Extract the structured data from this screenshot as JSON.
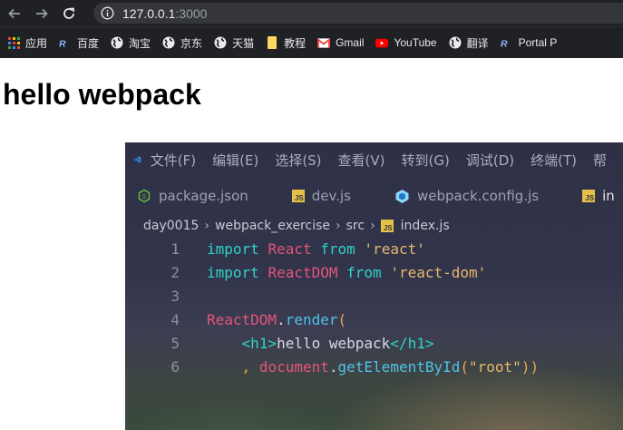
{
  "browser": {
    "url_host": "127.0.0.1",
    "url_port": ":3000",
    "bookmarks": [
      {
        "label": "应用",
        "icon": "apps-grid-icon"
      },
      {
        "label": "百度",
        "icon": "rb-logo-icon"
      },
      {
        "label": "淘宝",
        "icon": "globe-icon"
      },
      {
        "label": "京东",
        "icon": "globe-icon"
      },
      {
        "label": "天猫",
        "icon": "globe-icon"
      },
      {
        "label": "教程",
        "icon": "folder-icon"
      },
      {
        "label": "Gmail",
        "icon": "gmail-icon"
      },
      {
        "label": "YouTube",
        "icon": "youtube-icon"
      },
      {
        "label": "翻译",
        "icon": "globe-icon"
      },
      {
        "label": "Portal P",
        "icon": "rb-logo-icon"
      }
    ]
  },
  "page": {
    "heading": "hello webpack"
  },
  "vscode": {
    "menu": [
      "文件(F)",
      "编辑(E)",
      "选择(S)",
      "查看(V)",
      "转到(G)",
      "调试(D)",
      "终端(T)",
      "帮"
    ],
    "tabs": [
      {
        "label": "package.json",
        "icon": "npm-json-icon"
      },
      {
        "label": "dev.js",
        "icon": "js-file-icon"
      },
      {
        "label": "webpack.config.js",
        "icon": "webpack-icon"
      },
      {
        "label": "in",
        "icon": "js-file-icon"
      }
    ],
    "breadcrumb": [
      "day0015",
      "webpack_exercise",
      "src",
      "index.js"
    ],
    "line_numbers": [
      "1",
      "2",
      "3",
      "4",
      "5",
      "6"
    ],
    "code": {
      "l1": {
        "kw1": "import",
        "id": "React",
        "kw2": "from",
        "str": "'react'"
      },
      "l2": {
        "kw1": "import",
        "id": "ReactDOM",
        "kw2": "from",
        "str": "'react-dom'"
      },
      "l4": {
        "obj": "ReactDOM",
        "dot": ".",
        "fn": "render",
        "paren": "("
      },
      "l5": {
        "open": "<h1>",
        "text": "hello webpack",
        "close": "</h1>"
      },
      "l6": {
        "comma": ",",
        "obj": "document",
        "dot": ".",
        "fn": "getElementById",
        "paren_open": "(",
        "str": "\"root\"",
        "paren_close": "))"
      }
    }
  },
  "colors": {
    "chrome_bg": "#202124",
    "omnibox_bg": "#35363a",
    "vscode_blue": "#2c8ee8",
    "js_yellow": "#e5c04b"
  }
}
